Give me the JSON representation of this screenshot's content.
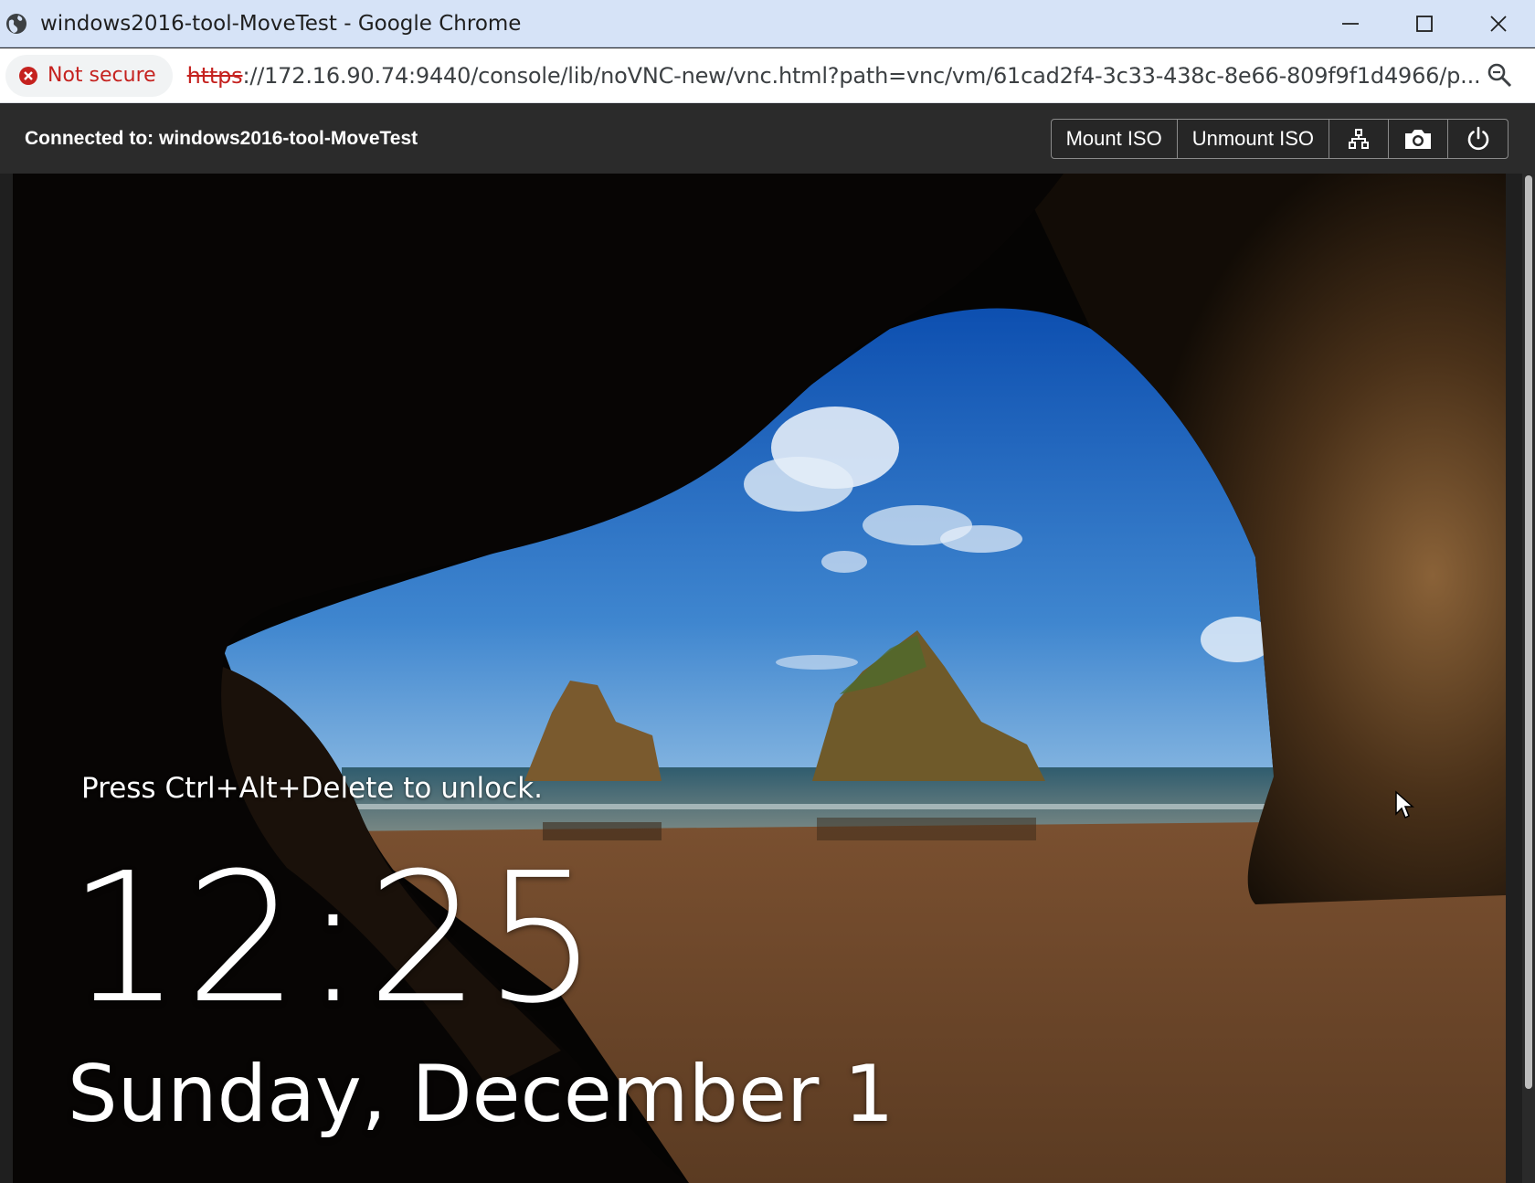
{
  "window": {
    "title": "windows2016-tool-MoveTest - Google Chrome",
    "controls": [
      "minimize",
      "maximize",
      "close"
    ]
  },
  "address_bar": {
    "security_label": "Not secure",
    "url_scheme": "https",
    "url_rest": "://172.16.90.74:9440/console/lib/noVNC-new/vnc.html?path=vnc/vm/61cad2f4-3c33-438c-8e66-809f9f1d4966/p..."
  },
  "vnc_toolbar": {
    "status": "Connected to: windows2016-tool-MoveTest",
    "mount_iso_label": "Mount ISO",
    "unmount_iso_label": "Unmount ISO",
    "icon_buttons": [
      "network-icon",
      "camera-icon",
      "power-icon"
    ]
  },
  "lock_screen": {
    "hint": "Press Ctrl+Alt+Delete to unlock.",
    "time": "12:25",
    "date": "Sunday, December 1"
  },
  "colors": {
    "titlebar_bg": "#d6e3f7",
    "not_secure": "#c5221f",
    "toolbar_bg": "#2b2b2b",
    "sky": "#2a6fc4",
    "sand": "#8a5e35"
  }
}
